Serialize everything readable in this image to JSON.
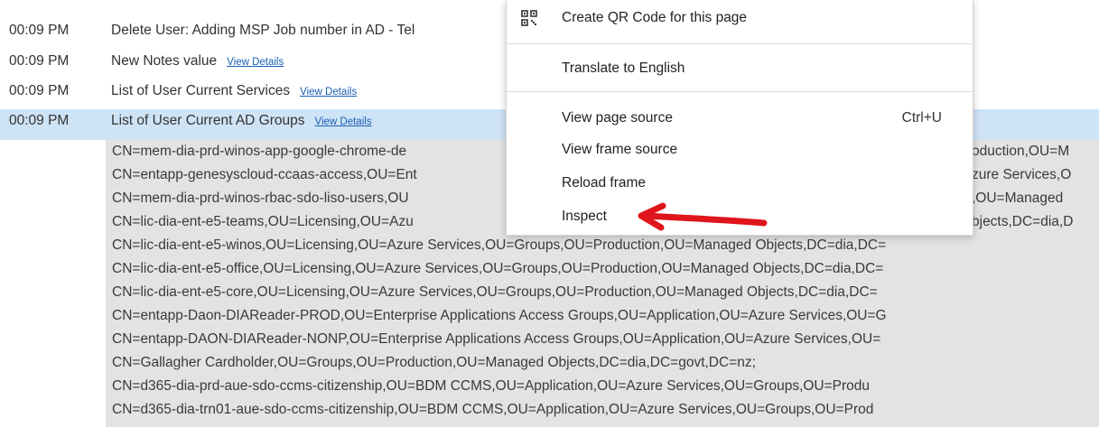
{
  "log": {
    "rows": [
      {
        "time": "00:09 PM",
        "text": "Delete User: Adding MSP Job number in AD - Tel",
        "link": ""
      },
      {
        "time": "00:09 PM",
        "text": "New Notes value",
        "link": "View Details"
      },
      {
        "time": "00:09 PM",
        "text": "List of User Current Services",
        "link": "View Details"
      },
      {
        "time": "00:09 PM",
        "text": "List of User Current AD Groups",
        "link": "View Details"
      }
    ],
    "selected_color": "#cfe3f6",
    "details": [
      "CN=mem-dia-prd-winos-app-google-chrome-de",
      "CN=entapp-genesyscloud-ccaas-access,OU=Ent",
      "CN=mem-dia-prd-winos-rbac-sdo-liso-users,OU",
      "CN=lic-dia-ent-e5-teams,OU=Licensing,OU=Azu",
      "CN=lic-dia-ent-e5-winos,OU=Licensing,OU=Azure Services,OU=Groups,OU=Production,OU=Managed Objects,DC=dia,DC=",
      "CN=lic-dia-ent-e5-office,OU=Licensing,OU=Azure Services,OU=Groups,OU=Production,OU=Managed Objects,DC=dia,DC=",
      "CN=lic-dia-ent-e5-core,OU=Licensing,OU=Azure Services,OU=Groups,OU=Production,OU=Managed Objects,DC=dia,DC=",
      "CN=entapp-Daon-DIAReader-PROD,OU=Enterprise Applications Access Groups,OU=Application,OU=Azure Services,OU=G",
      "CN=entapp-DAON-DIAReader-NONP,OU=Enterprise Applications Access Groups,OU=Application,OU=Azure Services,OU=",
      "CN=Gallagher Cardholder,OU=Groups,OU=Production,OU=Managed Objects,DC=dia,DC=govt,DC=nz;",
      "CN=d365-dia-prd-aue-sdo-ccms-citizenship,OU=BDM CCMS,OU=Application,OU=Azure Services,OU=Groups,OU=Produ",
      "CN=d365-dia-trn01-aue-sdo-ccms-citizenship,OU=BDM CCMS,OU=Application,OU=Azure Services,OU=Groups,OU=Prod"
    ],
    "details_right": [
      "oduction,OU=M",
      "zure Services,O",
      ",OU=Managed",
      "bjects,DC=dia,D"
    ]
  },
  "context_menu": {
    "items": [
      {
        "label": "Create QR Code for this page",
        "shortcut": "",
        "icon": "qr-code-icon"
      },
      {
        "label": "Translate to English",
        "shortcut": ""
      },
      {
        "label": "View page source",
        "shortcut": "Ctrl+U"
      },
      {
        "label": "View frame source",
        "shortcut": ""
      },
      {
        "label": "Reload frame",
        "shortcut": ""
      },
      {
        "label": "Inspect",
        "shortcut": ""
      }
    ]
  },
  "annotation": {
    "icon": "red-arrow-annotation",
    "color": "#e0141b"
  }
}
